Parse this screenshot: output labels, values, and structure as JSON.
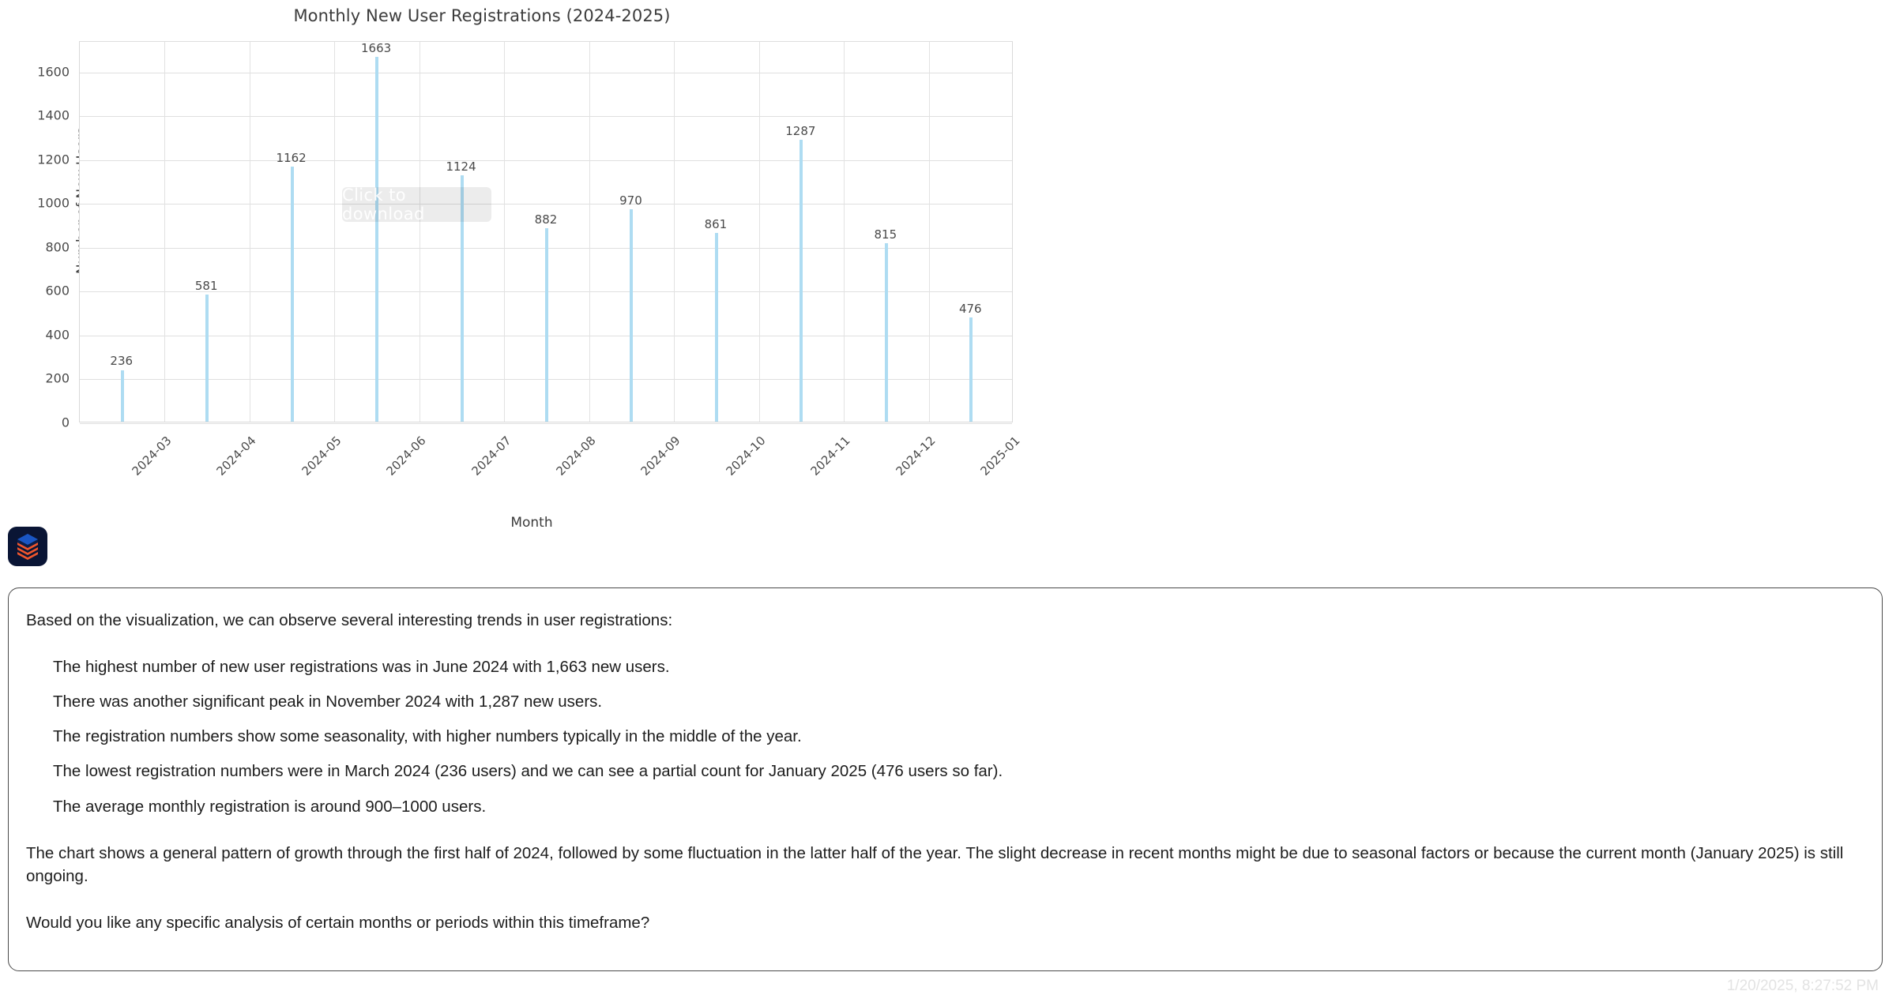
{
  "chart_data": {
    "type": "bar",
    "title": "Monthly New User Registrations (2024-2025)",
    "xlabel": "Month",
    "ylabel": "Number of New Users",
    "categories": [
      "2024-03",
      "2024-04",
      "2024-05",
      "2024-06",
      "2024-07",
      "2024-08",
      "2024-09",
      "2024-10",
      "2024-11",
      "2024-12",
      "2025-01"
    ],
    "values": [
      236,
      581,
      1162,
      1663,
      1124,
      882,
      970,
      861,
      1287,
      815,
      476
    ],
    "value_labels": [
      "236",
      "581",
      "1162",
      "1663",
      "1124",
      "882",
      "970",
      "861",
      "1287",
      "815",
      "476"
    ],
    "ylim": [
      0,
      1740
    ],
    "yticks": [
      0,
      200,
      400,
      600,
      800,
      1000,
      1200,
      1400,
      1600
    ],
    "ytick_labels": [
      "0",
      "200",
      "400",
      "600",
      "800",
      "1000",
      "1200",
      "1400",
      "1600"
    ],
    "grid": true,
    "legend": false,
    "bar_color": "#aedcf2",
    "grid_color": "#dfdfdf"
  },
  "overlay": {
    "download_label": "Click to download"
  },
  "avatar": {
    "icon": "stacked-layers-logo",
    "background": "#0a1535",
    "layer_top_color": "#1a56c4",
    "layer_accent_color": "#f0562d"
  },
  "response": {
    "intro": "Based on the visualization, we can observe several interesting trends in user registrations:",
    "bullets": [
      "The highest number of new user registrations was in June 2024 with 1,663 new users.",
      "There was another significant peak in November 2024 with 1,287 new users.",
      "The registration numbers show some seasonality, with higher numbers typically in the middle of the year.",
      "The lowest registration numbers were in March 2024 (236 users) and we can see a partial count for January 2025 (476 users so far).",
      "The average monthly registration is around 900–1000 users."
    ],
    "paragraph_2": "The chart shows a general pattern of growth through the first half of 2024, followed by some fluctuation in the latter half of the year. The slight decrease in recent months might be due to seasonal factors or because the current month (January 2025) is still ongoing.",
    "paragraph_3": "Would you like any specific analysis of certain months or periods within this timeframe?"
  },
  "footer": {
    "timestamp": "1/20/2025, 8:27:52 PM"
  }
}
